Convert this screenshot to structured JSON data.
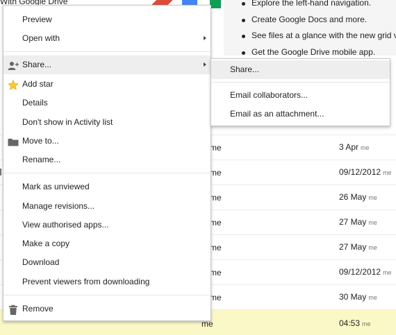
{
  "background": {
    "top_text": "With Google Drive",
    "promo_items": [
      "Explore the left-hand navigation.",
      "Create Google Docs and more.",
      "See files at a glance with the new grid vi",
      "Get the Google Drive mobile app."
    ],
    "rows": [
      {
        "owner": "me",
        "date": "3 Apr",
        "modified_by": "me",
        "highlight": false
      },
      {
        "owner": "me",
        "date": "09/12/2012",
        "modified_by": "me",
        "highlight": false
      },
      {
        "owner": "me",
        "date": "26 May",
        "modified_by": "me",
        "highlight": false
      },
      {
        "owner": "me",
        "date": "27 May",
        "modified_by": "me",
        "highlight": false
      },
      {
        "owner": "me",
        "date": "27 May",
        "modified_by": "me",
        "highlight": false
      },
      {
        "owner": "me",
        "date": "09/12/2012",
        "modified_by": "me",
        "highlight": false
      },
      {
        "owner": "me",
        "date": "30 May",
        "modified_by": "me",
        "highlight": false
      },
      {
        "owner": "me",
        "date": "04:53",
        "modified_by": "me",
        "highlight": true
      }
    ]
  },
  "context_menu": {
    "preview": "Preview",
    "open_with": "Open with",
    "share": "Share...",
    "add_star": "Add star",
    "details": "Details",
    "dont_show": "Don't show in Activity list",
    "move_to": "Move to...",
    "rename": "Rename...",
    "mark_unviewed": "Mark as unviewed",
    "manage_revisions": "Manage revisions...",
    "view_apps": "View authorised apps...",
    "make_copy": "Make a copy",
    "download": "Download",
    "prevent_download": "Prevent viewers from downloading",
    "remove": "Remove",
    "icons": {
      "share": "add-person-icon",
      "star": "star-icon",
      "move": "folder-icon",
      "remove": "trash-icon"
    }
  },
  "share_submenu": {
    "share": "Share...",
    "email_collaborators": "Email collaborators...",
    "email_attachment": "Email as an attachment..."
  },
  "colors": {
    "menu_hover": "#eeeeee",
    "star": "#f7c934",
    "row_highlight": "#fbf8c7",
    "logo_red": "#dd4b39",
    "logo_blue": "#4285f4",
    "logo_green": "#0f9d58"
  }
}
